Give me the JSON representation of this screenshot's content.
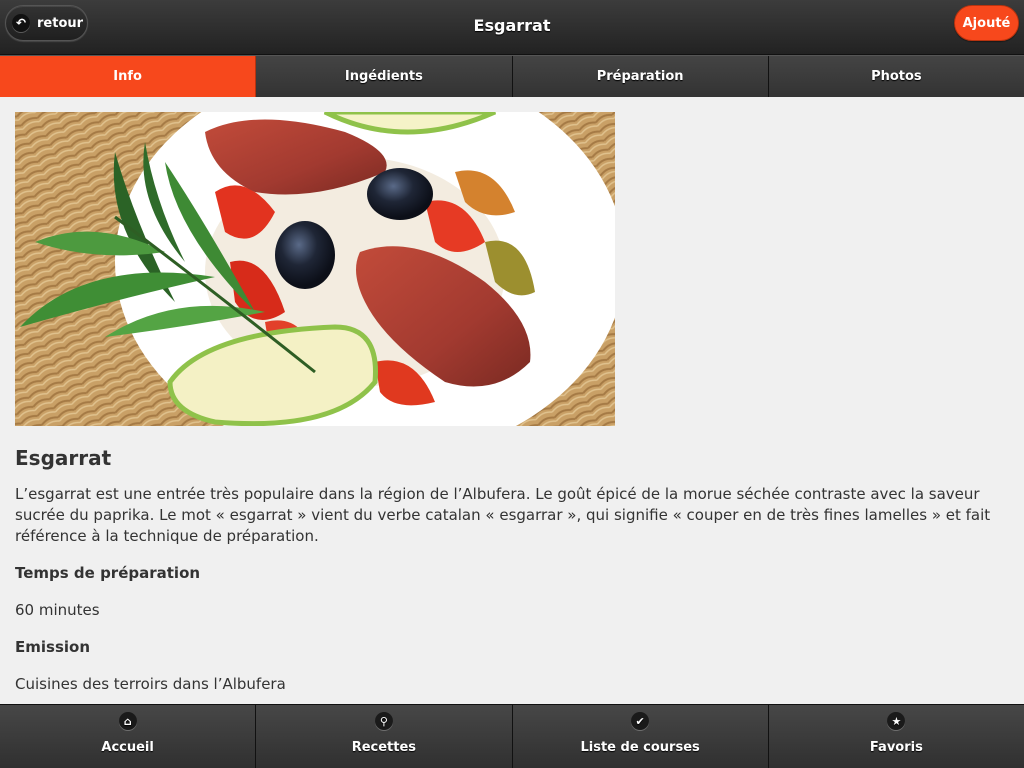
{
  "header": {
    "title": "Esgarrat",
    "back_label": "retour",
    "back_icon": "back-arrow-icon",
    "added_label": "Ajouté"
  },
  "tabs": [
    {
      "label": "Info",
      "active": true
    },
    {
      "label": "Ingédients",
      "active": false
    },
    {
      "label": "Préparation",
      "active": false
    },
    {
      "label": "Photos",
      "active": false
    }
  ],
  "recipe": {
    "photo_alt": "Plat d'esgarrat : morue séchée, poivrons rouges, olives noires, citron vert",
    "title": "Esgarrat",
    "description": "L’esgarrat est une entrée très populaire dans la région de l’Albufera. Le goût épicé de la morue séchée contraste avec la saveur sucrée du paprika. Le mot « esgarrat » vient du verbe catalan « esgarrar », qui signifie « couper en de très fines lamelles » et fait référence à la technique de préparation.",
    "prep_time_label": "Temps de préparation",
    "prep_time_value": "60 minutes",
    "emission_label": "Emission",
    "emission_value": "Cuisines des terroirs dans l’Albufera"
  },
  "footer": [
    {
      "label": "Accueil",
      "icon": "home-icon",
      "glyph": "⌂"
    },
    {
      "label": "Recettes",
      "icon": "search-icon",
      "glyph": "⚲"
    },
    {
      "label": "Liste de courses",
      "icon": "check-icon",
      "glyph": "✔"
    },
    {
      "label": "Favoris",
      "icon": "star-icon",
      "glyph": "★"
    }
  ],
  "colors": {
    "accent": "#f7481c",
    "bar_dark": "#2b2b2b",
    "background": "#f0f0f0"
  }
}
